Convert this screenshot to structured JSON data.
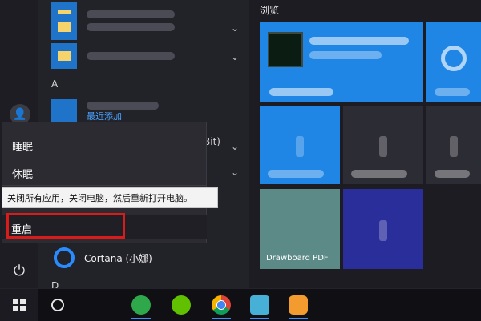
{
  "start_menu": {
    "app_list": {
      "letter_A": "A",
      "letter_D": "D",
      "items": [
        {
          "sub_label": "最近添加"
        },
        {
          "label": "Cortana (小娜)"
        }
      ],
      "partial_visible": "Bit)"
    },
    "power_menu": {
      "items": [
        "睡眠",
        "休眠",
        "重启"
      ],
      "tooltip": "关闭所有应用，关闭电脑，然后重新打开电脑。"
    },
    "tiles": {
      "group_title": "浏览",
      "tile_labels": [
        "Drawboard PDF"
      ]
    }
  },
  "taskbar": {
    "apps": [
      "start-button",
      "search",
      "ie",
      "green-plus",
      "chrome",
      "notes",
      "briefcase"
    ]
  },
  "colors": {
    "accent_blue": "#1f73c8",
    "tile_blue": "#1f86e6",
    "tile_dark_blue": "#2a2e9b",
    "tile_teal": "#5c8a87",
    "highlight_red": "#d81b1b"
  }
}
